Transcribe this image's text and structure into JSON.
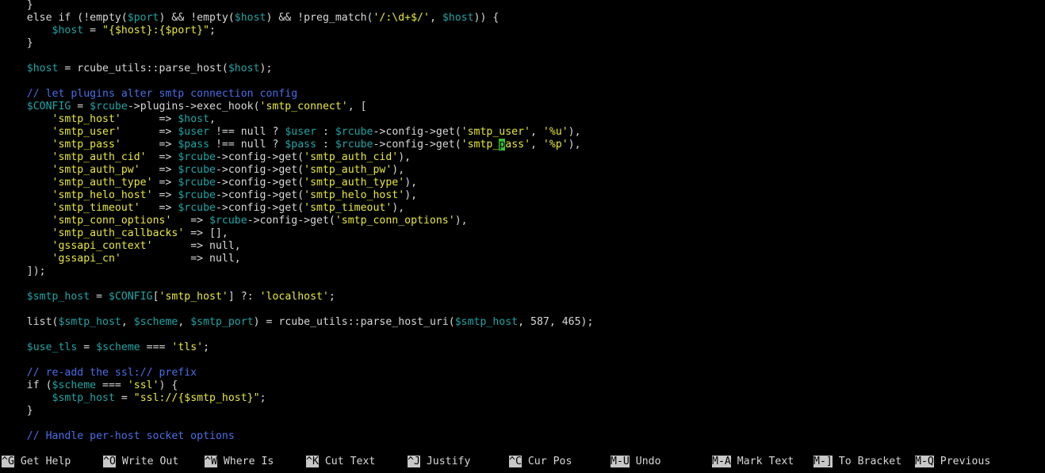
{
  "editor": {
    "lines": [
      [
        {
          "t": "    }",
          "c": "plain"
        }
      ],
      [
        {
          "t": "    else if (!empty(",
          "c": "plain"
        },
        {
          "t": "$port",
          "c": "var"
        },
        {
          "t": ") && !empty(",
          "c": "plain"
        },
        {
          "t": "$host",
          "c": "var"
        },
        {
          "t": ") && !preg_match(",
          "c": "plain"
        },
        {
          "t": "'/:\\d+$/'",
          "c": "str"
        },
        {
          "t": ", ",
          "c": "plain"
        },
        {
          "t": "$host",
          "c": "var"
        },
        {
          "t": ")) {",
          "c": "plain"
        }
      ],
      [
        {
          "t": "        ",
          "c": "plain"
        },
        {
          "t": "$host",
          "c": "var"
        },
        {
          "t": " = ",
          "c": "plain"
        },
        {
          "t": "\"{$host}:{$port}\"",
          "c": "str"
        },
        {
          "t": ";",
          "c": "plain"
        }
      ],
      [
        {
          "t": "    }",
          "c": "plain"
        }
      ],
      [
        {
          "t": "",
          "c": "plain"
        }
      ],
      [
        {
          "t": "    ",
          "c": "plain"
        },
        {
          "t": "$host",
          "c": "var"
        },
        {
          "t": " = rcube_utils::parse_host(",
          "c": "plain"
        },
        {
          "t": "$host",
          "c": "var"
        },
        {
          "t": ");",
          "c": "plain"
        }
      ],
      [
        {
          "t": "",
          "c": "plain"
        }
      ],
      [
        {
          "t": "    // let plugins alter smtp connection config",
          "c": "com"
        }
      ],
      [
        {
          "t": "    ",
          "c": "plain"
        },
        {
          "t": "$CONFIG",
          "c": "var"
        },
        {
          "t": " = ",
          "c": "plain"
        },
        {
          "t": "$rcube",
          "c": "var"
        },
        {
          "t": "->plugins->exec_hook(",
          "c": "plain"
        },
        {
          "t": "'smtp_connect'",
          "c": "str"
        },
        {
          "t": ", [",
          "c": "plain"
        }
      ],
      [
        {
          "t": "        ",
          "c": "plain"
        },
        {
          "t": "'smtp_host'",
          "c": "str"
        },
        {
          "t": "      => ",
          "c": "plain"
        },
        {
          "t": "$host",
          "c": "var"
        },
        {
          "t": ",",
          "c": "plain"
        }
      ],
      [
        {
          "t": "        ",
          "c": "plain"
        },
        {
          "t": "'smtp_user'",
          "c": "str"
        },
        {
          "t": "      => ",
          "c": "plain"
        },
        {
          "t": "$user",
          "c": "var"
        },
        {
          "t": " !== null ? ",
          "c": "plain"
        },
        {
          "t": "$user",
          "c": "var"
        },
        {
          "t": " : ",
          "c": "plain"
        },
        {
          "t": "$rcube",
          "c": "var"
        },
        {
          "t": "->config->get(",
          "c": "plain"
        },
        {
          "t": "'smtp_user'",
          "c": "str"
        },
        {
          "t": ", ",
          "c": "plain"
        },
        {
          "t": "'%u'",
          "c": "str"
        },
        {
          "t": "),",
          "c": "plain"
        }
      ],
      [
        {
          "t": "        ",
          "c": "plain"
        },
        {
          "t": "'smtp_pass'",
          "c": "str"
        },
        {
          "t": "      => ",
          "c": "plain"
        },
        {
          "t": "$pass",
          "c": "var"
        },
        {
          "t": " !== null ? ",
          "c": "plain"
        },
        {
          "t": "$pass",
          "c": "var"
        },
        {
          "t": " : ",
          "c": "plain"
        },
        {
          "t": "$rcube",
          "c": "var"
        },
        {
          "t": "->config->get(",
          "c": "plain"
        },
        {
          "t": "'smtp_",
          "c": "str"
        },
        {
          "t": "p",
          "c": "cursor"
        },
        {
          "t": "ass'",
          "c": "str"
        },
        {
          "t": ", ",
          "c": "plain"
        },
        {
          "t": "'%p'",
          "c": "str"
        },
        {
          "t": "),",
          "c": "plain"
        }
      ],
      [
        {
          "t": "        ",
          "c": "plain"
        },
        {
          "t": "'smtp_auth_cid'",
          "c": "str"
        },
        {
          "t": "  => ",
          "c": "plain"
        },
        {
          "t": "$rcube",
          "c": "var"
        },
        {
          "t": "->config->get(",
          "c": "plain"
        },
        {
          "t": "'smtp_auth_cid'",
          "c": "str"
        },
        {
          "t": "),",
          "c": "plain"
        }
      ],
      [
        {
          "t": "        ",
          "c": "plain"
        },
        {
          "t": "'smtp_auth_pw'",
          "c": "str"
        },
        {
          "t": "   => ",
          "c": "plain"
        },
        {
          "t": "$rcube",
          "c": "var"
        },
        {
          "t": "->config->get(",
          "c": "plain"
        },
        {
          "t": "'smtp_auth_pw'",
          "c": "str"
        },
        {
          "t": "),",
          "c": "plain"
        }
      ],
      [
        {
          "t": "        ",
          "c": "plain"
        },
        {
          "t": "'smtp_auth_type'",
          "c": "str"
        },
        {
          "t": " => ",
          "c": "plain"
        },
        {
          "t": "$rcube",
          "c": "var"
        },
        {
          "t": "->config->get(",
          "c": "plain"
        },
        {
          "t": "'smtp_auth_type'",
          "c": "str"
        },
        {
          "t": "),",
          "c": "plain"
        }
      ],
      [
        {
          "t": "        ",
          "c": "plain"
        },
        {
          "t": "'smtp_helo_host'",
          "c": "str"
        },
        {
          "t": " => ",
          "c": "plain"
        },
        {
          "t": "$rcube",
          "c": "var"
        },
        {
          "t": "->config->get(",
          "c": "plain"
        },
        {
          "t": "'smtp_helo_host'",
          "c": "str"
        },
        {
          "t": "),",
          "c": "plain"
        }
      ],
      [
        {
          "t": "        ",
          "c": "plain"
        },
        {
          "t": "'smtp_timeout'",
          "c": "str"
        },
        {
          "t": "   => ",
          "c": "plain"
        },
        {
          "t": "$rcube",
          "c": "var"
        },
        {
          "t": "->config->get(",
          "c": "plain"
        },
        {
          "t": "'smtp_timeout'",
          "c": "str"
        },
        {
          "t": "),",
          "c": "plain"
        }
      ],
      [
        {
          "t": "        ",
          "c": "plain"
        },
        {
          "t": "'smtp_conn_options'",
          "c": "str"
        },
        {
          "t": "   => ",
          "c": "plain"
        },
        {
          "t": "$rcube",
          "c": "var"
        },
        {
          "t": "->config->get(",
          "c": "plain"
        },
        {
          "t": "'smtp_conn_options'",
          "c": "str"
        },
        {
          "t": "),",
          "c": "plain"
        }
      ],
      [
        {
          "t": "        ",
          "c": "plain"
        },
        {
          "t": "'smtp_auth_callbacks'",
          "c": "str"
        },
        {
          "t": " => [],",
          "c": "plain"
        }
      ],
      [
        {
          "t": "        ",
          "c": "plain"
        },
        {
          "t": "'gssapi_context'",
          "c": "str"
        },
        {
          "t": "      => null,",
          "c": "plain"
        }
      ],
      [
        {
          "t": "        ",
          "c": "plain"
        },
        {
          "t": "'gssapi_cn'",
          "c": "str"
        },
        {
          "t": "           => null,",
          "c": "plain"
        }
      ],
      [
        {
          "t": "    ]);",
          "c": "plain"
        }
      ],
      [
        {
          "t": "",
          "c": "plain"
        }
      ],
      [
        {
          "t": "    ",
          "c": "plain"
        },
        {
          "t": "$smtp_host",
          "c": "var"
        },
        {
          "t": " = ",
          "c": "plain"
        },
        {
          "t": "$CONFIG",
          "c": "var"
        },
        {
          "t": "[",
          "c": "plain"
        },
        {
          "t": "'smtp_host'",
          "c": "str"
        },
        {
          "t": "] ?: ",
          "c": "plain"
        },
        {
          "t": "'localhost'",
          "c": "str"
        },
        {
          "t": ";",
          "c": "plain"
        }
      ],
      [
        {
          "t": "",
          "c": "plain"
        }
      ],
      [
        {
          "t": "    list(",
          "c": "plain"
        },
        {
          "t": "$smtp_host",
          "c": "var"
        },
        {
          "t": ", ",
          "c": "plain"
        },
        {
          "t": "$scheme",
          "c": "var"
        },
        {
          "t": ", ",
          "c": "plain"
        },
        {
          "t": "$smtp_port",
          "c": "var"
        },
        {
          "t": ") = rcube_utils::parse_host_uri(",
          "c": "plain"
        },
        {
          "t": "$smtp_host",
          "c": "var"
        },
        {
          "t": ", 587, 465);",
          "c": "plain"
        }
      ],
      [
        {
          "t": "",
          "c": "plain"
        }
      ],
      [
        {
          "t": "    ",
          "c": "plain"
        },
        {
          "t": "$use_tls",
          "c": "var"
        },
        {
          "t": " = ",
          "c": "plain"
        },
        {
          "t": "$scheme",
          "c": "var"
        },
        {
          "t": " === ",
          "c": "plain"
        },
        {
          "t": "'tls'",
          "c": "str"
        },
        {
          "t": ";",
          "c": "plain"
        }
      ],
      [
        {
          "t": "",
          "c": "plain"
        }
      ],
      [
        {
          "t": "    // re-add the ssl:// prefix",
          "c": "com"
        }
      ],
      [
        {
          "t": "    if (",
          "c": "plain"
        },
        {
          "t": "$scheme",
          "c": "var"
        },
        {
          "t": " === ",
          "c": "plain"
        },
        {
          "t": "'ssl'",
          "c": "str"
        },
        {
          "t": ") {",
          "c": "plain"
        }
      ],
      [
        {
          "t": "        ",
          "c": "plain"
        },
        {
          "t": "$smtp_host",
          "c": "var"
        },
        {
          "t": " = ",
          "c": "plain"
        },
        {
          "t": "\"ssl://{$smtp_host}\"",
          "c": "str"
        },
        {
          "t": ";",
          "c": "plain"
        }
      ],
      [
        {
          "t": "    }",
          "c": "plain"
        }
      ],
      [
        {
          "t": "",
          "c": "plain"
        }
      ],
      [
        {
          "t": "    // Handle per-host socket options",
          "c": "com"
        }
      ]
    ]
  },
  "shortcuts": {
    "row1": [
      {
        "key": "^G",
        "label": "Get Help"
      },
      {
        "key": "^O",
        "label": "Write Out"
      },
      {
        "key": "^W",
        "label": "Where Is"
      },
      {
        "key": "^K",
        "label": "Cut Text"
      },
      {
        "key": "^J",
        "label": "Justify"
      },
      {
        "key": "^C",
        "label": "Cur Pos"
      },
      {
        "key": "M-U",
        "label": "Undo"
      },
      {
        "key": "M-A",
        "label": "Mark Text"
      },
      {
        "key": "M-]",
        "label": "To Bracket"
      },
      {
        "key": "M-Q",
        "label": "Previous"
      }
    ]
  },
  "colors": {
    "background": "#000000",
    "variable": "#1fa5a5",
    "string": "#e8e83a",
    "comment": "#4a6ee8",
    "cursor": "#34c034",
    "shortcut_key_bg": "#c8c8c8"
  }
}
